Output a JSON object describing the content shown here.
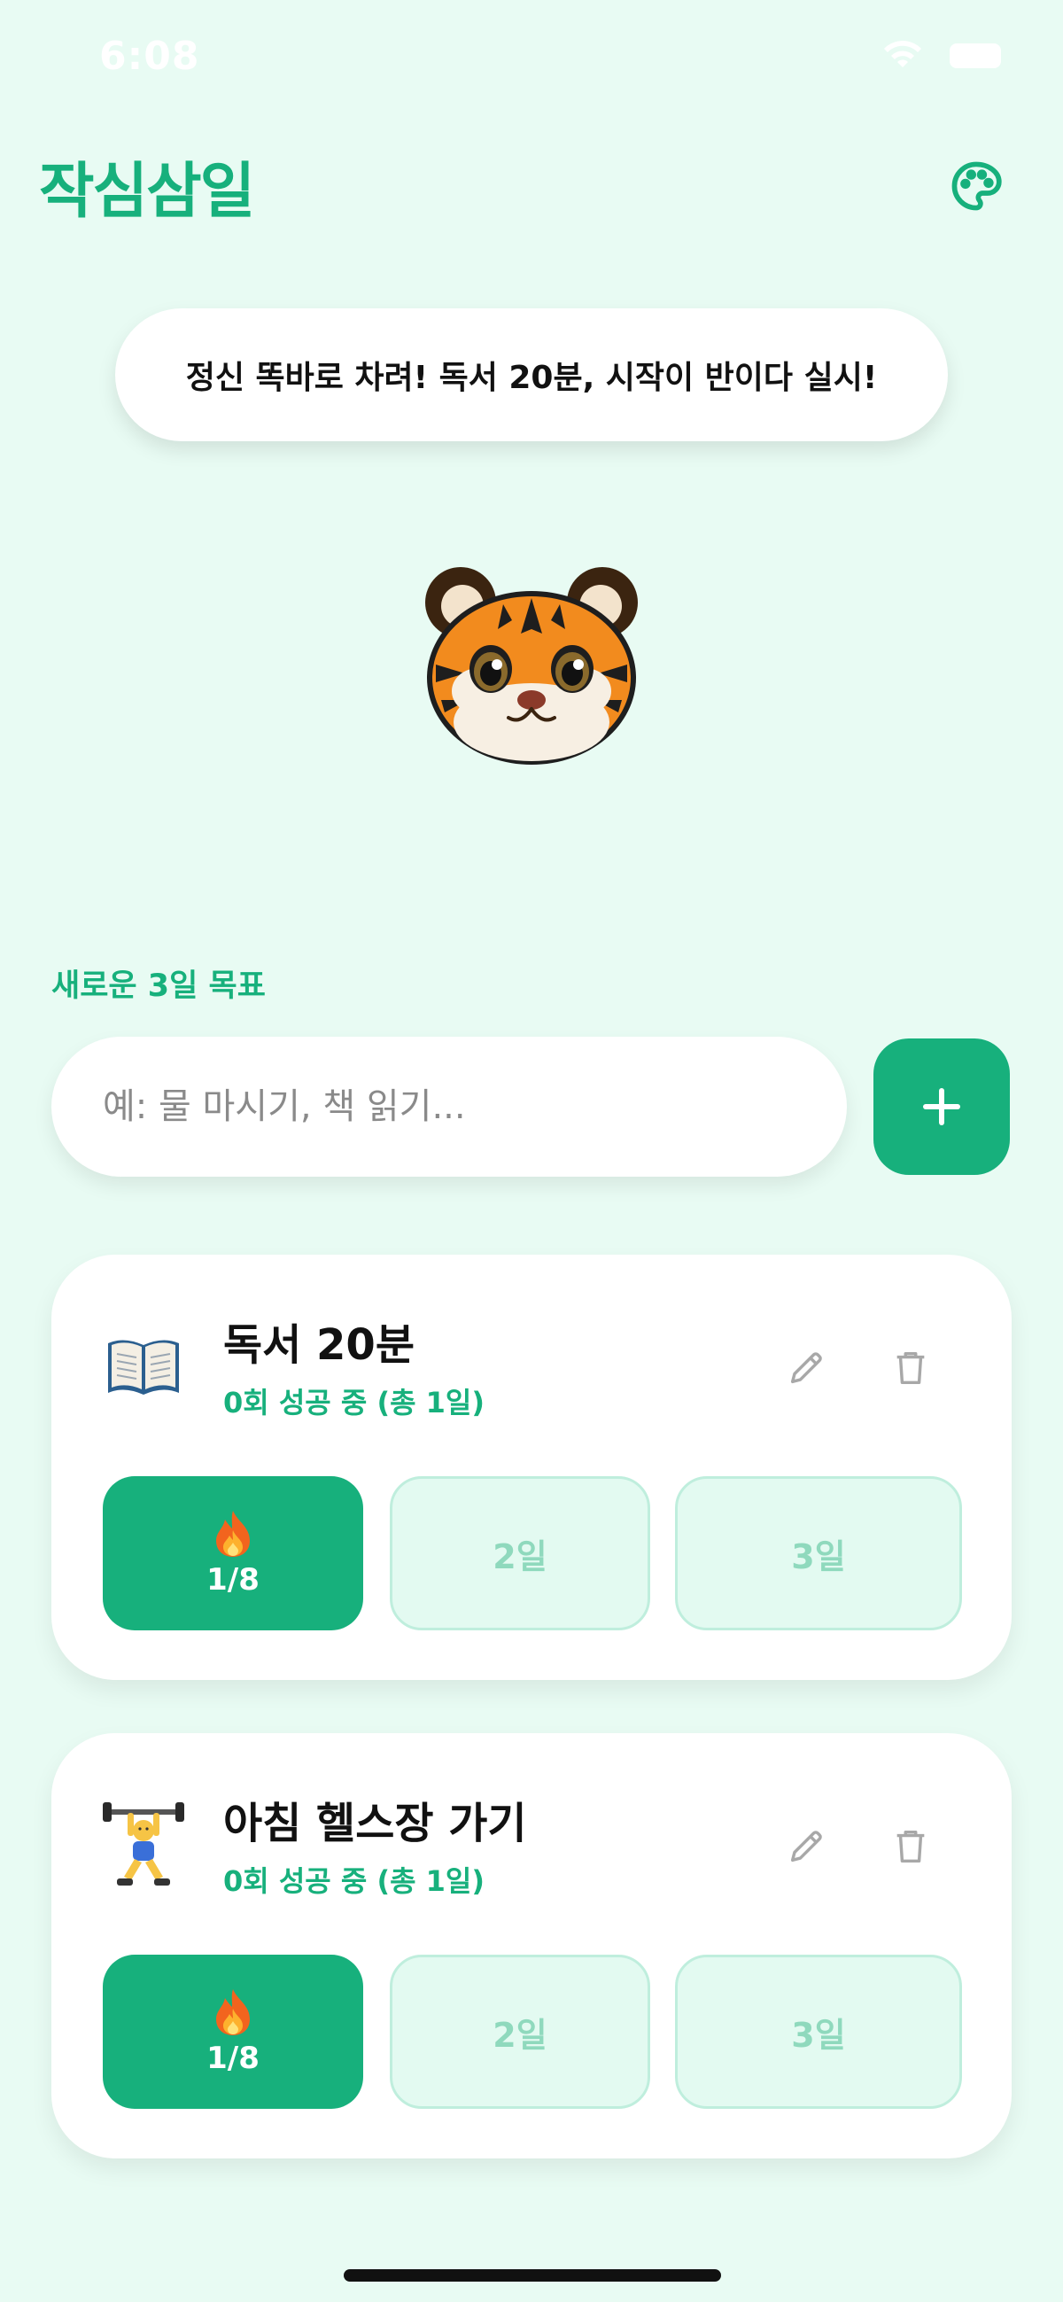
{
  "status_bar": {
    "time": "6:08",
    "wifi_icon": "wifi-icon",
    "battery_icon": "battery-icon"
  },
  "header": {
    "title": "작심삼일",
    "palette_icon": "palette-icon"
  },
  "mascot": {
    "message": "정신 똑바로 차려! 독서 20분, 시작이 반이다 실시!",
    "icon": "tiger-face-icon"
  },
  "new_goal": {
    "label": "새로운 3일 목표",
    "placeholder": "예: 물 마시기, 책 읽기...",
    "add_icon": "plus-icon"
  },
  "goals": [
    {
      "icon": "open-book-icon",
      "title": "독서 20분",
      "status": "0회 성공 중 (총 1일)",
      "days": [
        {
          "icon": "fire-icon",
          "label": "1/8",
          "active": true
        },
        {
          "label": "2일",
          "active": false
        },
        {
          "label": "3일",
          "active": false
        }
      ]
    },
    {
      "icon": "weightlifter-icon",
      "title": "아침 헬스장 가기",
      "status": "0회 성공 중 (총 1일)",
      "days": [
        {
          "icon": "fire-icon",
          "label": "1/8",
          "active": true
        },
        {
          "label": "2일",
          "active": false
        },
        {
          "label": "3일",
          "active": false
        }
      ]
    }
  ],
  "colors": {
    "background": "#e8fbf3",
    "accent": "#17b07c",
    "inactive_day": "#e3faf1",
    "inactive_day_text": "#8fd9bd"
  }
}
